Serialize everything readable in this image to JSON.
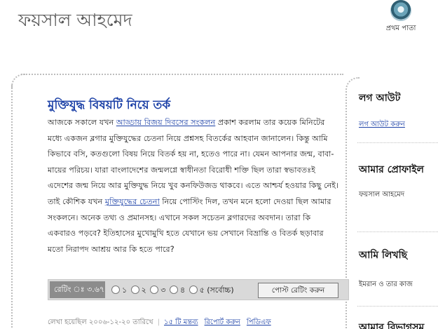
{
  "header": {
    "site_title": "ফয়সাল আহমেদ",
    "home_label": "প্রথম পাতা"
  },
  "post": {
    "title": "মুক্তিযুদ্ধ বিষয়টি নিয়ে তর্ক",
    "body": {
      "part1": "আজকে সকালে যখন ",
      "link1": "আড্ডায় বিজয় দিবসের সংকলন",
      "part2": " প্রকাশ করলাম তার কয়েক মিনিটের মধ্যে একজন ব্লগার মুক্তিযুদ্ধের চেতনা নিয়ে প্রশ্নসহ বিতর্কের আহবান জানালেন। কিন্তু আমি কিভাবে বসি, কতগুলো বিষয় নিয়ে বিতর্ক হয় না, হতেও পারে না। যেমন আপনার জন্ম, বাবা-মায়ের পরিচয়। যারা বাংলাদেশের জন্মলগ্নে স্বাধীনতা বিরোধী শক্তি ছিল তারা স্বভাবতঃই এদেশের জন্ম নিয়ে আর মুক্তিযুদ্ধ নিয়ে খুব কনফিউজড থাকবে। এতে আশ্চর্য হওয়ার কিছু নেই। তাই কৌশিক যখন ",
      "link2": "মুক্তিযুদ্ধের চেতনা",
      "part3": " নিয়ে পোস্টিং দিল, তখন মনে হলো দেওয়া ছিল আমার সংকলনে। অনেক তথ্য ও প্রমানসহ। এখানে সকল সচেতন ব্লগারদের অবদান। তারা কি একবারও পড়বে? ইতিহাসের মুখোমুখি হতে যেখানে ভয় সেখানে বিভ্রান্তি ও বিতর্ক ছড়াবার মতো নিরাপদ আশ্রয় আর কি হতে পারে?"
    },
    "rating": {
      "label": "রেটিং ঃ ৩.৬৭",
      "options": [
        "১",
        "২",
        "৩",
        "৪",
        "৫ (সর্বোচ্চ)"
      ],
      "button": "পোস্ট রেটিং করুন"
    },
    "meta": {
      "written": "লেখা হয়েছিল ২০০৬-১২-২০ তারিখে",
      "comments": "১৫ টি মন্তব্য",
      "report": "রিপোর্ট করুন",
      "pdf": "পিডিএফ"
    }
  },
  "sidebar": {
    "logout_heading": "লগ আউট",
    "logout_link": "লগ আউট করুন",
    "profile_heading": "আমার প্রোফাইল",
    "profile_name": "ফয়সাল আহমেদ",
    "writing_heading": "আমি লিখছি",
    "writing_item": "ইমরান ও তার কাজ",
    "category_heading": "আমার বিভাগসমূ"
  }
}
